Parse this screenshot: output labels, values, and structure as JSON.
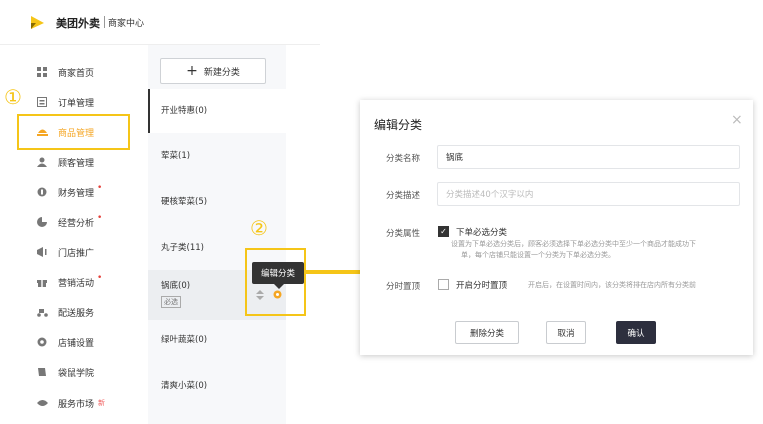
{
  "header": {
    "brand": "美团外卖",
    "subtitle": "商家中心"
  },
  "sidebar": {
    "items": [
      {
        "label": "商家首页",
        "icon": "grid-icon"
      },
      {
        "label": "订单管理",
        "icon": "order-icon"
      },
      {
        "label": "商品管理",
        "icon": "product-icon",
        "active": true
      },
      {
        "label": "顾客管理",
        "icon": "user-icon"
      },
      {
        "label": "财务管理",
        "icon": "finance-icon",
        "dot": "•"
      },
      {
        "label": "经营分析",
        "icon": "chart-icon",
        "dot": "•"
      },
      {
        "label": "门店推广",
        "icon": "promote-icon"
      },
      {
        "label": "营销活动",
        "icon": "gift-icon",
        "dot": "•"
      },
      {
        "label": "配送服务",
        "icon": "delivery-icon"
      },
      {
        "label": "店铺设置",
        "icon": "settings-icon"
      },
      {
        "label": "袋鼠学院",
        "icon": "book-icon"
      },
      {
        "label": "服务市场",
        "icon": "market-icon",
        "badge": "新"
      }
    ]
  },
  "annotations": {
    "step1": "①",
    "step2": "②"
  },
  "categories": {
    "new_button": "新建分类",
    "items": [
      {
        "label": "开业特惠(0)"
      },
      {
        "label": "荤菜(1)"
      },
      {
        "label": "硬核荤菜(5)"
      },
      {
        "label": "丸子类(11)"
      },
      {
        "label": "锅底(0)",
        "tag": "必选"
      },
      {
        "label": "绿叶蔬菜(0)"
      },
      {
        "label": "清爽小菜(0)"
      }
    ],
    "tooltip": "编辑分类"
  },
  "modal": {
    "title": "编辑分类",
    "close": "×",
    "name_label": "分类名称",
    "name_value": "锅底",
    "desc_label": "分类描述",
    "desc_placeholder": "分类描述40个汉字以内",
    "attr_label": "分类属性",
    "attr_option": "下单必选分类",
    "attr_hint_1": "设置为下单必选分类后，顾客必须选择下单必选分类中至少一个商品才能成功下",
    "attr_hint_2": "单，每个店铺只能设置一个分类为下单必选分类。",
    "pin_label": "分时置顶",
    "pin_option": "开启分时置顶",
    "pin_hint": "开启后，在设置时间内，该分类将排在店内所有分类前",
    "delete_button": "删除分类",
    "cancel_button": "取消",
    "confirm_button": "确认"
  },
  "colors": {
    "accent": "#f5c518",
    "primary_dark": "#2d2f3e",
    "active_text": "#f5a623"
  }
}
